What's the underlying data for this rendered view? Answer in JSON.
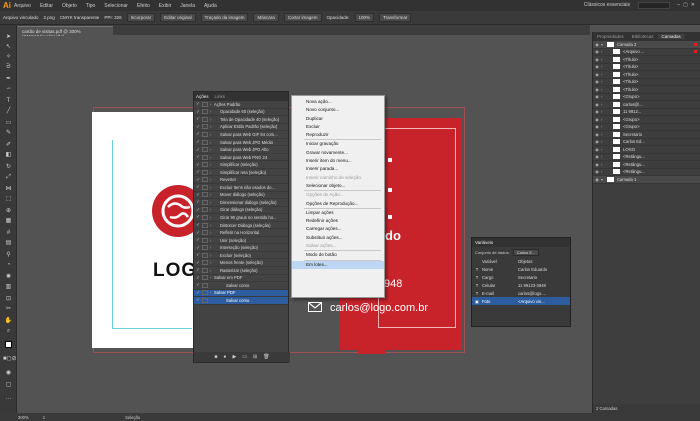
{
  "menubar": {
    "app_logo": "Ai",
    "items": [
      "Arquivo",
      "Editar",
      "Objeto",
      "Tipo",
      "Selecionar",
      "Efeito",
      "Exibir",
      "Janela",
      "Ajuda"
    ],
    "workspace": "Clássicos essenciais"
  },
  "controlbar": {
    "status": "Arquivo vinculado",
    "file": "2.png",
    "color_info": "CMYK transparente",
    "ppi": "PPI: 326",
    "buttons": [
      "Incorporar",
      "Editar original",
      "Traçado da imagem",
      "Máscara",
      "Cortar imagem"
    ],
    "opacity_label": "Opacidade:",
    "opacity_value": "100%",
    "transform": "Transformar"
  },
  "doc_tab": "cartão de visitas.pdf @ 300% (CMYK/Visualização)",
  "artboard": {
    "logo_text": "LOG",
    "name_fragment": "rdo",
    "phone_fragment": "948",
    "email": "carlos@logo.com.br"
  },
  "acoes_panel": {
    "tab_active": "Ações",
    "tab_other": "Links",
    "rows": [
      {
        "label": "Ações Padrão",
        "indent": 0,
        "selected": false
      },
      {
        "label": "Opacidade 60 (seleção)",
        "indent": 1,
        "selected": false
      },
      {
        "label": "Tela de Opacidade 40 (seleção)",
        "indent": 1,
        "selected": false
      },
      {
        "label": "Aplicar Estilo Padrão (seleção)",
        "indent": 1,
        "selected": false
      },
      {
        "label": "Salvar para Web GIF 64 com...",
        "indent": 1,
        "selected": false
      },
      {
        "label": "Salvar para Web JPG Médio",
        "indent": 1,
        "selected": false
      },
      {
        "label": "Salvar para Web JPG Alto",
        "indent": 1,
        "selected": false
      },
      {
        "label": "Salvar para Web PNG 24",
        "indent": 1,
        "selected": false
      },
      {
        "label": "Simplificar (seleção)",
        "indent": 1,
        "selected": false
      },
      {
        "label": "Simplificar reta (seleção)",
        "indent": 1,
        "selected": false
      },
      {
        "label": "Reverter",
        "indent": 1,
        "selected": false
      },
      {
        "label": "Excluir Itens não usados do...",
        "indent": 1,
        "selected": false
      },
      {
        "label": "Mover diálogo (seleção)",
        "indent": 1,
        "selected": false
      },
      {
        "label": "Dimensionar diálogo (seleção)",
        "indent": 1,
        "selected": false
      },
      {
        "label": "Girar diálogo (seleção)",
        "indent": 1,
        "selected": false
      },
      {
        "label": "Girar 90 graus no sentido ho...",
        "indent": 1,
        "selected": false
      },
      {
        "label": "Distorcer Diálogo (seleção)",
        "indent": 1,
        "selected": false
      },
      {
        "label": "Refletir na Horizontal",
        "indent": 1,
        "selected": false
      },
      {
        "label": "Unir (seleção)",
        "indent": 1,
        "selected": false
      },
      {
        "label": "Interseção (seleção)",
        "indent": 1,
        "selected": false
      },
      {
        "label": "Excluir (seleção)",
        "indent": 1,
        "selected": false
      },
      {
        "label": "Menos frente (seleção)",
        "indent": 1,
        "selected": false
      },
      {
        "label": "Rasterizar (seleção)",
        "indent": 1,
        "selected": false
      },
      {
        "label": "Salvar em PDF",
        "indent": 0,
        "selected": false
      },
      {
        "label": "Salvar como",
        "indent": 2,
        "selected": false
      },
      {
        "label": "Salvar PDF",
        "indent": 0,
        "selected": true
      },
      {
        "label": "Salvar como",
        "indent": 2,
        "selected": true
      }
    ]
  },
  "context_menu": {
    "groups": [
      [
        {
          "label": "Nova ação...",
          "disabled": false
        },
        {
          "label": "Novo conjunto...",
          "disabled": false
        },
        {
          "label": "Duplicar",
          "disabled": false
        },
        {
          "label": "Excluir",
          "disabled": false
        },
        {
          "label": "Reproduzir",
          "disabled": false
        }
      ],
      [
        {
          "label": "Iniciar gravação",
          "disabled": false
        },
        {
          "label": "Gravar novamente...",
          "disabled": false
        },
        {
          "label": "Inserir item do menu...",
          "disabled": false
        },
        {
          "label": "Inserir parada...",
          "disabled": false
        },
        {
          "label": "Inserir caminho de seleção",
          "disabled": true
        },
        {
          "label": "Selecionar objeto...",
          "disabled": false
        }
      ],
      [
        {
          "label": "Opções de Ação...",
          "disabled": true
        },
        {
          "label": "Opções de Reprodução...",
          "disabled": false
        }
      ],
      [
        {
          "label": "Limpar ações",
          "disabled": false
        },
        {
          "label": "Redefinir ações",
          "disabled": false
        },
        {
          "label": "Carregar ações...",
          "disabled": false
        },
        {
          "label": "Substituir ações...",
          "disabled": false
        },
        {
          "label": "Salvar ações...",
          "disabled": true
        }
      ],
      [
        {
          "label": "Modo de botão",
          "disabled": false
        }
      ],
      [
        {
          "label": "Em lotes...",
          "disabled": false,
          "highlighted": true
        }
      ]
    ]
  },
  "variaveis_panel": {
    "title": "Variáveis",
    "dataset_label": "Conjunto de dados:",
    "dataset_value": "Carlos E...",
    "col_var": "Variável",
    "col_obj": "Objetos",
    "rows": [
      {
        "icon": "T",
        "name": "Nome",
        "obj": "Carlos Eduardo",
        "selected": false
      },
      {
        "icon": "T",
        "name": "Cargo",
        "obj": "Secretario",
        "selected": false
      },
      {
        "icon": "T",
        "name": "Celular",
        "obj": "11 99123-3948",
        "selected": false
      },
      {
        "icon": "T",
        "name": "E-mail",
        "obj": "carlos@logo....",
        "selected": false
      },
      {
        "icon": "▣",
        "name": "Foto",
        "obj": "<Arquivo vin...",
        "selected": true
      }
    ]
  },
  "right_panel": {
    "tabs": [
      "Propriedades",
      "Bibliotecas",
      "Camadas"
    ],
    "active_tab": "Camadas",
    "rows": [
      {
        "label": "Camada 2",
        "layer": true,
        "mark": true
      },
      {
        "label": "<Arquivo ...",
        "layer": false,
        "mark": true
      },
      {
        "label": "<Título>",
        "layer": false,
        "mark": false
      },
      {
        "label": "<Título>",
        "layer": false,
        "mark": false
      },
      {
        "label": "<Título>",
        "layer": false,
        "mark": false
      },
      {
        "label": "<Título>",
        "layer": false,
        "mark": false
      },
      {
        "label": "<Título>",
        "layer": false,
        "mark": false
      },
      {
        "label": "<Grupo>",
        "layer": false,
        "mark": false
      },
      {
        "label": "carlos@l...",
        "layer": false,
        "mark": false
      },
      {
        "label": "11 9912...",
        "layer": false,
        "mark": false
      },
      {
        "label": "<Grupo>",
        "layer": false,
        "mark": false
      },
      {
        "label": "<Grupo>",
        "layer": false,
        "mark": false
      },
      {
        "label": "Secretario",
        "layer": false,
        "mark": false
      },
      {
        "label": "Carlos Ed...",
        "layer": false,
        "mark": false
      },
      {
        "label": "LOGO",
        "layer": false,
        "mark": false
      },
      {
        "label": "<Retângu...",
        "layer": false,
        "mark": false
      },
      {
        "label": "<Retângu...",
        "layer": false,
        "mark": false
      },
      {
        "label": "<Retângu...",
        "layer": false,
        "mark": false
      },
      {
        "label": "Camada 1",
        "layer": true,
        "mark": false
      }
    ],
    "footer": "2 Camadas"
  },
  "statusbar": {
    "zoom": "300%",
    "page": "1",
    "tool": "Seleção"
  },
  "colors": {
    "brand_red": "#c8232b",
    "selection_blue": "#2d5d9f",
    "menu_highlight": "#bcd6f4"
  }
}
